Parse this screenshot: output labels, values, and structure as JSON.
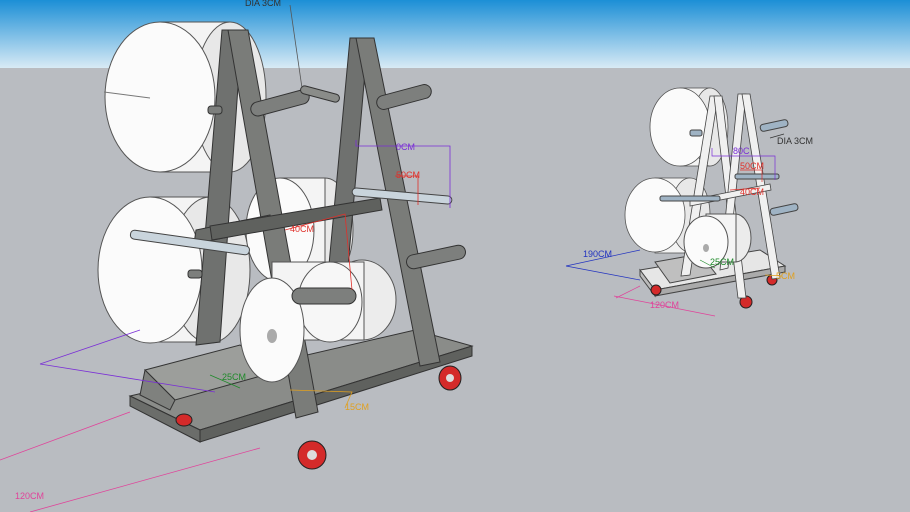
{
  "scene": {
    "sky_top": "#1c8fd6",
    "sky_bottom": "#d8eaf5",
    "ground": "#b9bcc1"
  },
  "labels": {
    "big_dia": "DIA 3CM",
    "big_width": "0CM",
    "big_50": "50CM",
    "big_40": "40CM",
    "big_25": "25CM",
    "big_15": "15CM",
    "big_120": "120CM",
    "small_dia": "DIA 3CM",
    "small_80": "80C",
    "small_50": "50CM",
    "small_40": "40CM",
    "small_190": "190CM",
    "small_25": "25CM",
    "small_15": "5CM",
    "small_120": "120CM"
  },
  "colors": {
    "frame": "#6f716f",
    "roll": "#f2f2f2",
    "pin": "#7d7f7d",
    "wheel": "#d42a2a",
    "dim_purple": "#7a2ed6",
    "dim_red": "#e0302a",
    "dim_pink": "#e0439a",
    "dim_green": "#1f8a2a",
    "dim_orange": "#e0a020",
    "dim_blue": "#2233c0",
    "dim_dark": "#333333"
  }
}
